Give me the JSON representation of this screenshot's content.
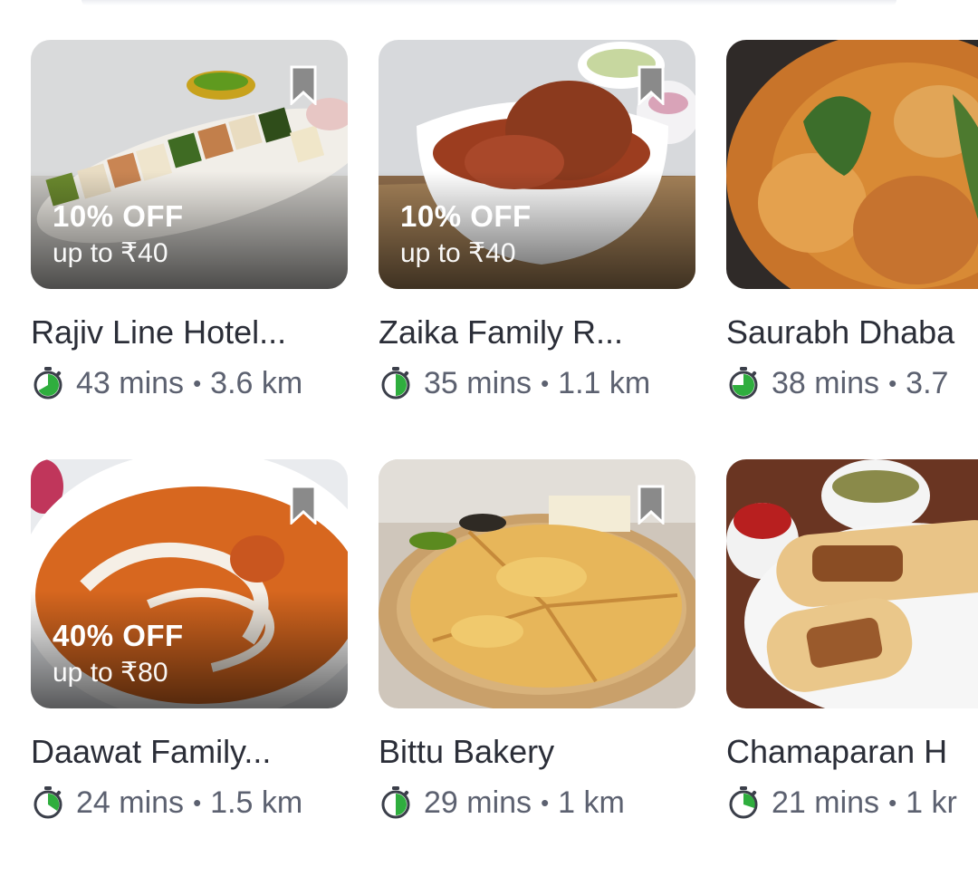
{
  "restaurants": [
    {
      "name": "Rajiv Line Hotel...",
      "time": "43 mins",
      "distance": "3.6 km",
      "offer_title": "10% OFF",
      "offer_sub": "up to ₹40",
      "timer_fill": 0.8,
      "image": "paneer-tikka-platter"
    },
    {
      "name": "Zaika Family R...",
      "time": "35 mins",
      "distance": "1.1 km",
      "offer_title": "10% OFF",
      "offer_sub": "up to ₹40",
      "timer_fill": 0.5,
      "image": "mutton-curry-bowl"
    },
    {
      "name": "Saurabh Dhaba",
      "time": "38 mins",
      "distance": "3.7",
      "offer_title": "",
      "offer_sub": "",
      "timer_fill": 0.75,
      "image": "chicken-curry-pan"
    },
    {
      "name": "Daawat Family...",
      "time": "24 mins",
      "distance": "1.5 km",
      "offer_title": "40% OFF",
      "offer_sub": "up to ₹80",
      "timer_fill": 0.4,
      "image": "butter-chicken-bowl"
    },
    {
      "name": "Bittu Bakery",
      "time": "29 mins",
      "distance": "1 km",
      "offer_title": "",
      "offer_sub": "",
      "timer_fill": 0.5,
      "image": "cheese-pizza-board"
    },
    {
      "name": "Chamaparan H",
      "time": "21 mins",
      "distance": "1 kr",
      "offer_title": "",
      "offer_sub": "",
      "timer_fill": 0.35,
      "image": "kathi-roll-plate"
    }
  ],
  "colors": {
    "timer_green": "#2fae3e",
    "timer_stroke": "#3b3f4a",
    "name_text": "#2b2e38",
    "meta_text": "#5c6170",
    "bookmark": "#8a8a8a"
  },
  "icons": {
    "timer": "stopwatch-icon",
    "bookmark": "bookmark-icon"
  },
  "separator": "•"
}
